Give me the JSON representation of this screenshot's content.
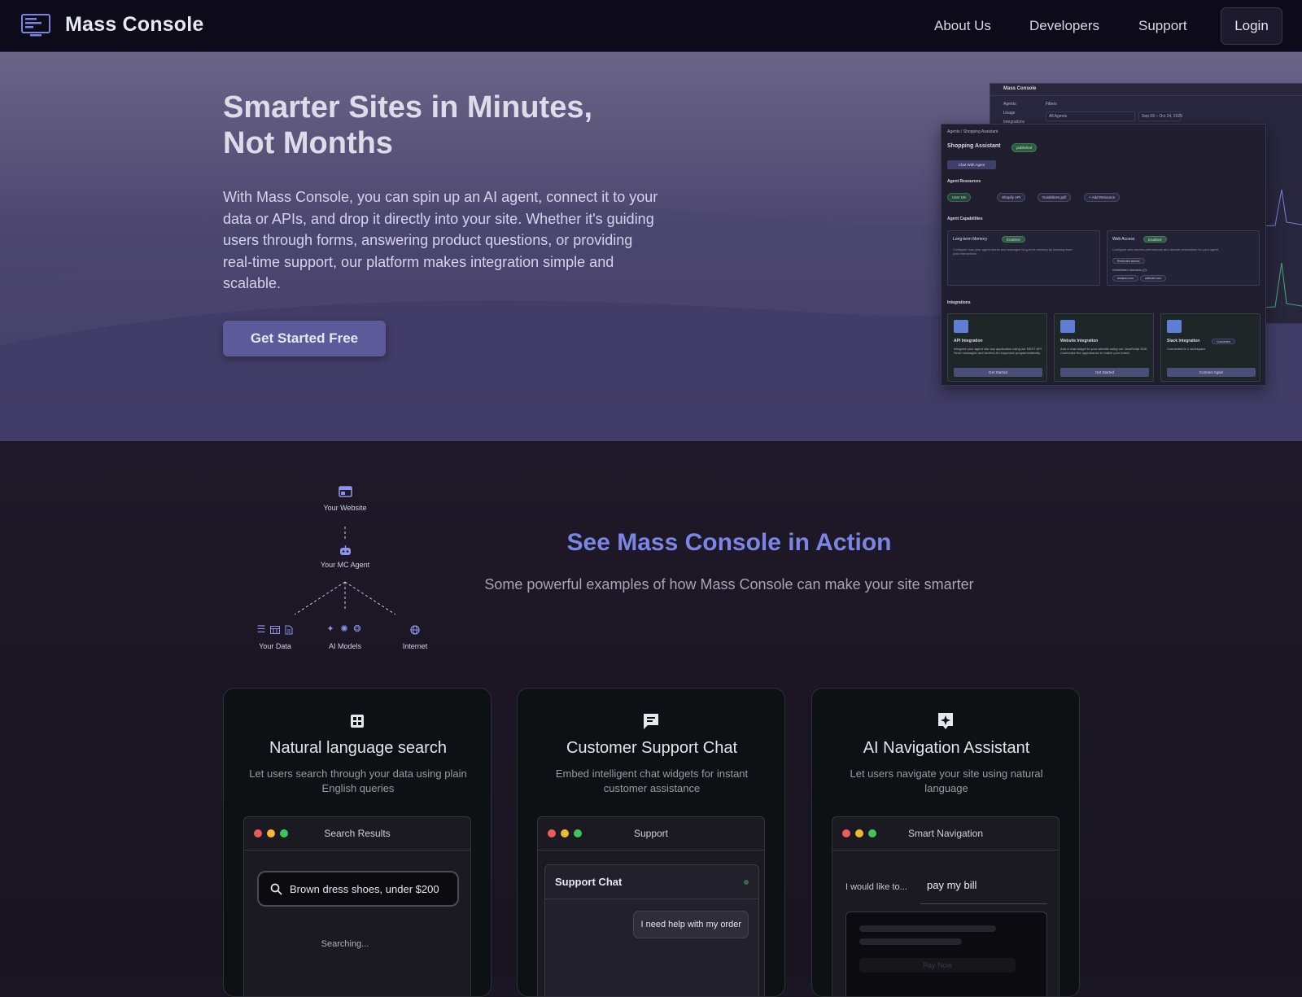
{
  "nav": {
    "brand": "Mass Console",
    "links": [
      "About Us",
      "Developers",
      "Support"
    ],
    "login": "Login"
  },
  "hero": {
    "title": "Smarter Sites in Minutes, Not Months",
    "body": "With Mass Console, you can spin up an AI agent, connect it to your data or APIs, and drop it directly into your site. Whether it's guiding users through forms, answering product questions, or providing real-time support, our platform makes integration simple and scalable.",
    "cta": "Get Started Free"
  },
  "mockup": {
    "back_brand": "Mass Console",
    "back_menu": [
      "Agents",
      "Usage",
      "Integrations"
    ],
    "back_filters": "Filters",
    "back_agent_select": "All Agents",
    "back_date": "Sep 09 – Oct 24, 2025",
    "breadcrumb": "Agents / Shopping Assistant",
    "agent_name": "Shopping Assistant",
    "status_badge": "published",
    "chat_btn": "Chat With Agent",
    "resources_title": "Agent Resources",
    "resources": [
      "User DB",
      "Shopify API",
      "Guidelines.pdf",
      "+ Add Resource"
    ],
    "capabilities_title": "Agent Capabilities",
    "cap1_title": "Long-term Memory",
    "cap1_badge": "Enabled",
    "cap1_desc": "Configure how your agent stores and manages long-term memory by learning from past interactions.",
    "cap2_title": "Web Access",
    "cap2_badge": "Enabled",
    "cap2_desc": "Configure web access permissions and domain restrictions for your agent.",
    "cap2_sub": "Restricted access",
    "cap2_domains_label": "Whitelisted domains (2):",
    "cap2_domains": [
      "amazon.com",
      "walmart.com"
    ],
    "integrations_title": "Integrations",
    "int1_title": "API Integration",
    "int1_desc": "Integrate your agent into any application using our REST API. Send messages and receive AI responses programmatically.",
    "int1_btn": "Get Started",
    "int2_title": "Website Integration",
    "int2_desc": "Add a chat widget to your website using our JavaScript SDK. Customize the appearance to match your brand.",
    "int2_btn": "Get Started",
    "int3_title": "Slack Integration",
    "int3_badge": "Connected",
    "int3_desc": "Connected to 1 workspace",
    "int3_btn": "Connect Again"
  },
  "diagram": {
    "website": "Your Website",
    "agent": "Your MC Agent",
    "data": "Your Data",
    "models": "AI Models",
    "internet": "Internet"
  },
  "section": {
    "title": "See Mass Console in Action",
    "subtitle": "Some powerful examples of how Mass Console can make your site smarter"
  },
  "cards": [
    {
      "title": "Natural language search",
      "desc": "Let users search through your data using plain English queries",
      "window_title": "Search Results",
      "query": "Brown dress shoes, under $200",
      "status": "Searching..."
    },
    {
      "title": "Customer Support Chat",
      "desc": "Embed intelligent chat widgets for instant customer assistance",
      "window_title": "Support",
      "chat_title": "Support Chat",
      "message": "I need help with my order"
    },
    {
      "title": "AI Navigation Assistant",
      "desc": "Let users navigate your site using natural language",
      "window_title": "Smart Navigation",
      "prompt_label": "I would like to...",
      "prompt_value": "pay my bill",
      "button": "Pay Now"
    }
  ]
}
